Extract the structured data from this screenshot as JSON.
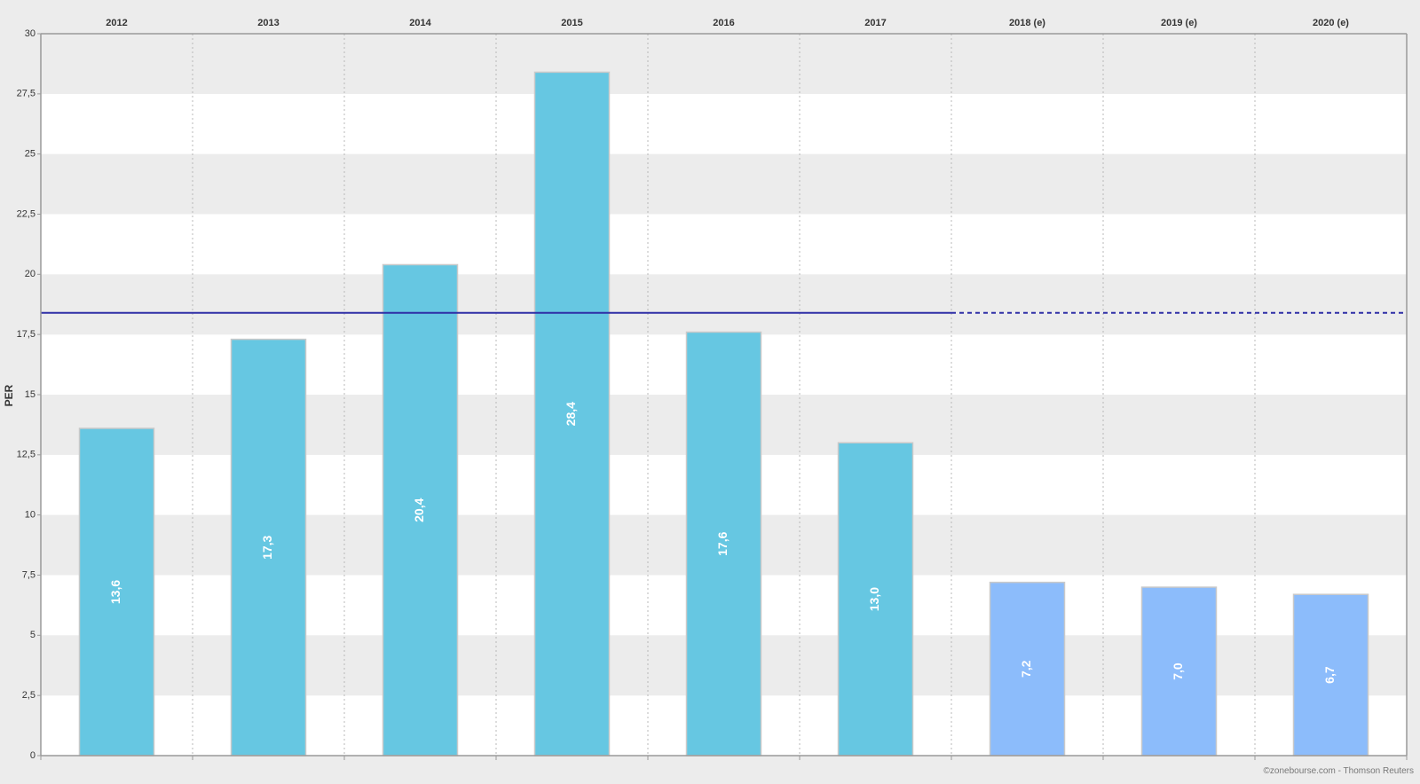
{
  "chart_data": {
    "type": "bar",
    "title": "",
    "xlabel": "",
    "ylabel": "PER",
    "categories": [
      "2012",
      "2013",
      "2014",
      "2015",
      "2016",
      "2017",
      "2018 (e)",
      "2019 (e)",
      "2020 (e)"
    ],
    "values": [
      13.6,
      17.3,
      20.4,
      28.4,
      17.6,
      13.0,
      7.2,
      7.0,
      6.7
    ],
    "value_labels": [
      "13,6",
      "17,3",
      "20,4",
      "28,4",
      "17,6",
      "13,0",
      "7,2",
      "7,0",
      "6,7"
    ],
    "estimated": [
      false,
      false,
      false,
      false,
      false,
      false,
      true,
      true,
      true
    ],
    "ylim": [
      0,
      30
    ],
    "yticks": [
      0,
      2.5,
      5,
      7.5,
      10,
      12.5,
      15,
      17.5,
      20,
      22.5,
      25,
      27.5,
      30
    ],
    "ytick_labels": [
      "0",
      "2,5",
      "5",
      "7,5",
      "10",
      "12,5",
      "15",
      "17,5",
      "20",
      "22,5",
      "25",
      "27,5",
      "30"
    ],
    "reference_line": {
      "value": 18.4,
      "solid_through": "2017",
      "dashed_after": true
    },
    "grid": true,
    "x_axis_position": "top",
    "colors": {
      "bar": "#66c7e2",
      "bar_estimated": "#8cbcfb",
      "reference_line": "#2e2ea6",
      "band_gray": "#ececec",
      "band_white": "#ffffff",
      "label_text": "#ffffff"
    }
  },
  "footer": {
    "credit": "©zonebourse.com - Thomson Reuters"
  }
}
